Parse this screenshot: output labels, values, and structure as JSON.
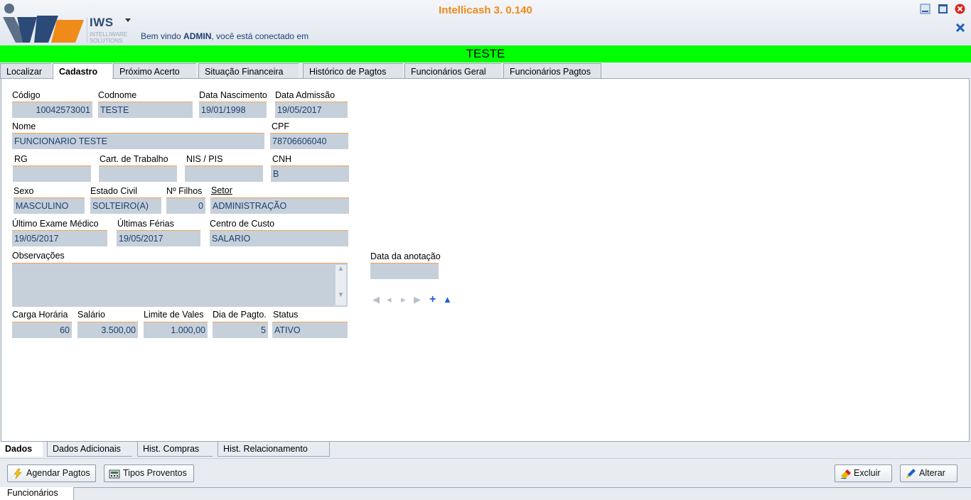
{
  "app": {
    "title": "Intellicash 3. 0.140",
    "logo_text": "IWS",
    "logo_sub": "INTELLIWARE SOLUTIONS",
    "welcome_prefix": "Bem vindo ",
    "welcome_user": "ADMIN",
    "welcome_suffix": ", você está conectado em",
    "banner": "TESTE"
  },
  "tabs": [
    "Localizar",
    "Cadastro",
    "Próximo Acerto",
    "Situação Financeira",
    "Histórico de Pagtos",
    "Funcionários Geral",
    "Funcionários Pagtos"
  ],
  "active_tab": "Cadastro",
  "form": {
    "codigo_label": "Código",
    "codigo": "10042573001",
    "codnome_label": "Codnome",
    "codnome": "TESTE",
    "nascimento_label": "Data Nascimento",
    "nascimento": "19/01/1998",
    "admissao_label": "Data Admissão",
    "admissao": "19/05/2017",
    "nome_label": "Nome",
    "nome": "FUNCIONARIO TESTE",
    "cpf_label": "CPF",
    "cpf": "78706606040",
    "rg_label": "RG",
    "rg": "",
    "cart_label": "Cart. de Trabalho",
    "cart": "",
    "nis_label": "NIS / PIS",
    "nis": "",
    "cnh_label": "CNH",
    "cnh": "B",
    "sexo_label": "Sexo",
    "sexo": "MASCULINO",
    "civil_label": "Estado Civil",
    "civil": "SOLTEIRO(A)",
    "filhos_label": "Nº Filhos",
    "filhos": "0",
    "setor_label": "Setor",
    "setor": "ADMINISTRAÇÃO",
    "exame_label": "Último Exame Médico",
    "exame": "19/05/2017",
    "ferias_label": "Últimas Férias",
    "ferias": "19/05/2017",
    "custo_label": "Centro de Custo",
    "custo": "SALARIO",
    "obs_label": "Observações",
    "anotacao_label": "Data da anotação",
    "anotacao": "",
    "carga_label": "Carga Horária",
    "carga": "60",
    "salario_label": "Salário",
    "salario": "3.500,00",
    "vales_label": "Limite de Vales",
    "vales": "1.000,00",
    "pagto_label": "Dia de Pagto.",
    "pagto": "5",
    "status_label": "Status",
    "status": "ATIVO"
  },
  "bottom_tabs": [
    "Dados",
    "Dados Adicionais",
    "Hist. Compras",
    "Hist. Relacionamento"
  ],
  "buttons": {
    "agendar": "Agendar Pagtos",
    "tipos": "Tipos Proventos",
    "excluir": "Excluir",
    "alterar": "Alterar"
  },
  "status_tab": "Funcionários",
  "colors": {
    "accent": "#f08a18",
    "banner": "#00ff00",
    "field": "#c6d0da",
    "field_text": "#1f3f6e"
  }
}
